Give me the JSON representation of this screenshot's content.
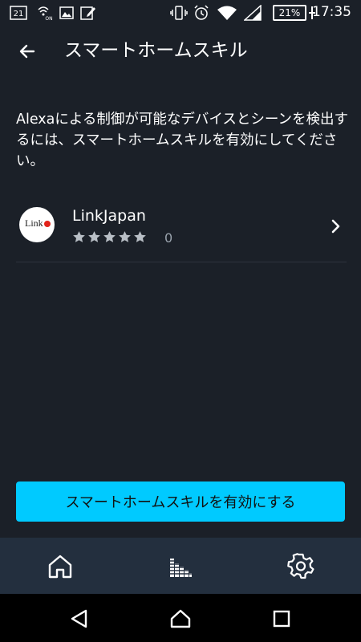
{
  "status_bar": {
    "time": "17:35",
    "battery_percent": "21%",
    "icons": [
      "21-icon",
      "wifi-calling-icon",
      "image-icon",
      "edit-icon",
      "vibrate-icon",
      "alarm-icon",
      "wifi-icon",
      "signal-icon",
      "battery-icon"
    ]
  },
  "app_bar": {
    "title": "スマートホームスキル"
  },
  "description": "Alexaによる制御が可能なデバイスとシーンを検出するには、スマートホームスキルを有効にしてください。",
  "skills": [
    {
      "name": "LinkJapan",
      "logo_text": "Link",
      "rating_count": "0",
      "stars": 5
    }
  ],
  "cta_label": "スマートホームスキルを有効にする",
  "bottom_nav": {
    "items": [
      "home-icon",
      "activity-icon",
      "settings-icon"
    ]
  },
  "colors": {
    "background": "#1b2028",
    "accent": "#00caff",
    "bottom_nav": "#232f3e"
  }
}
